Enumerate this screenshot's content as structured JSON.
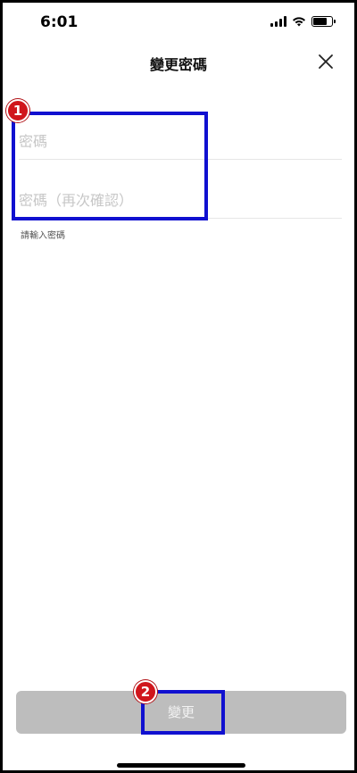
{
  "status_bar": {
    "time": "6:01",
    "icons": [
      "cellular-signal-icon",
      "wifi-icon",
      "battery-icon"
    ]
  },
  "header": {
    "title": "變更密碼",
    "close_icon": "close-icon"
  },
  "form": {
    "password_placeholder": "密碼",
    "confirm_placeholder": "密碼（再次確認）",
    "hint": "請輸入密碼"
  },
  "submit": {
    "label": "變更",
    "enabled": false
  },
  "annotations": [
    {
      "number": "1"
    },
    {
      "number": "2"
    }
  ],
  "colors": {
    "annotation_box": "#1010d0",
    "annotation_badge": "#d0161c",
    "button_disabled": "#bdbdbd"
  }
}
